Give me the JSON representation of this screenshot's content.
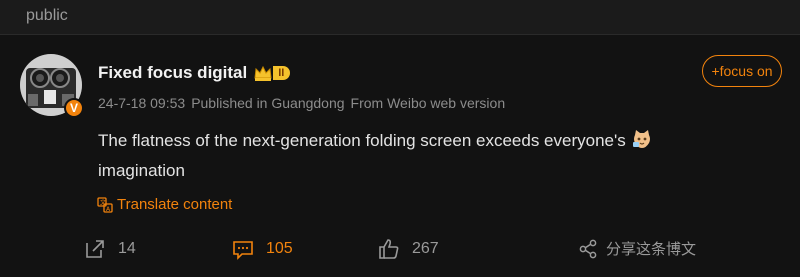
{
  "header": {
    "label": "public"
  },
  "post": {
    "author": {
      "name": "Fixed focus digital",
      "verified_badge": "V",
      "level": "II"
    },
    "follow_label": "+focus on",
    "meta": {
      "time": "24-7-18 09:53",
      "location": "Published in Guangdong",
      "source": "From Weibo web version"
    },
    "text_line1": "The flatness of the next-generation folding screen exceeds everyone's",
    "text_line2": "imagination",
    "translate_label": "Translate content",
    "actions": {
      "repost_count": "14",
      "comment_count": "105",
      "like_count": "267",
      "share_label": "分享这条博文"
    }
  },
  "colors": {
    "accent": "#f2830d",
    "background": "#121212",
    "text": "#e3e3e3",
    "muted": "#8c8c8c"
  },
  "icons": {
    "crown": "crown-icon",
    "translate": "translate-icon",
    "repost": "repost-icon",
    "comment": "comment-icon",
    "like": "like-icon",
    "share": "share-icon"
  }
}
